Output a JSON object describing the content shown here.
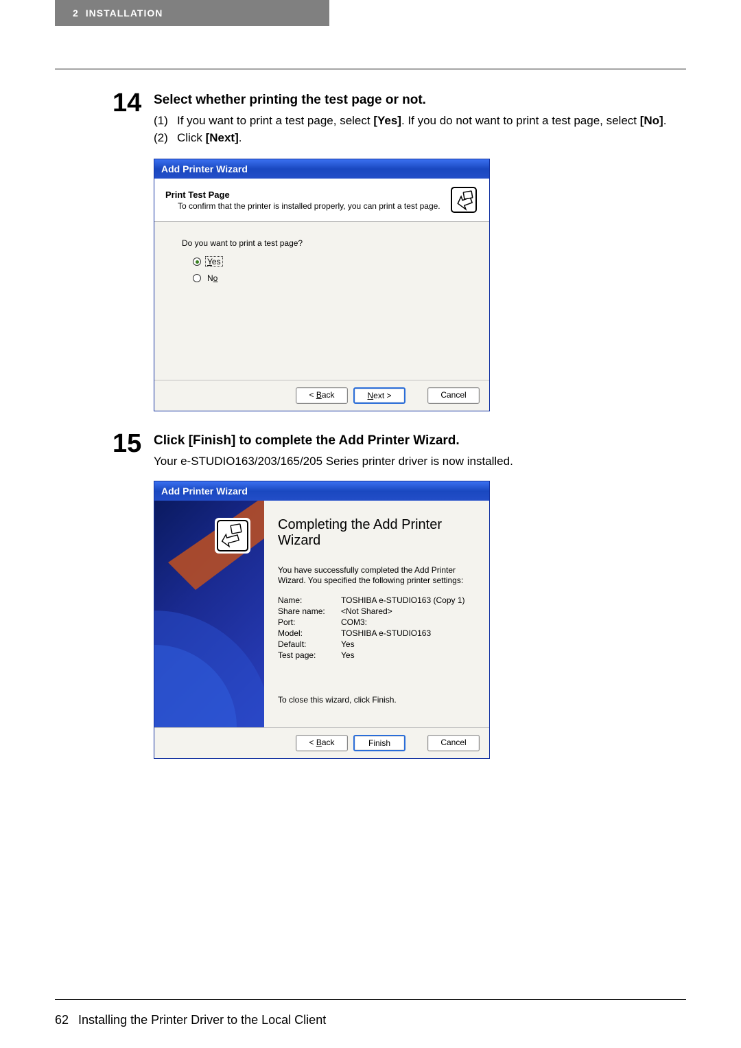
{
  "header": {
    "chapter_num": "2",
    "chapter_title": "INSTALLATION"
  },
  "step14": {
    "num": "14",
    "title": "Select whether printing the test page or not.",
    "sub1_num": "(1)",
    "sub1_text_a": "If you want to print a test page, select ",
    "sub1_bold_a": "[Yes]",
    "sub1_text_b": ". If you do not want to print a test page, select ",
    "sub1_bold_b": "[No]",
    "sub1_text_c": ".",
    "sub2_num": "(2)",
    "sub2_text_a": "Click ",
    "sub2_bold_a": "[Next]",
    "sub2_text_b": "."
  },
  "wizard1": {
    "title": "Add Printer Wizard",
    "header_title": "Print Test Page",
    "header_sub": "To confirm that the printer is installed properly, you can print a test page.",
    "question": "Do you want to print a test page?",
    "opt_yes_pre": "",
    "opt_yes_u": "Y",
    "opt_yes_post": "es",
    "opt_no_pre": "N",
    "opt_no_u": "o",
    "opt_no_post": "",
    "btn_back_pre": "< ",
    "btn_back_u": "B",
    "btn_back_post": "ack",
    "btn_next_u": "N",
    "btn_next_post": "ext >",
    "btn_cancel": "Cancel"
  },
  "step15": {
    "num": "15",
    "title": "Click [Finish] to complete the Add Printer Wizard.",
    "sub": "Your e-STUDIO163/203/165/205 Series printer driver is now installed."
  },
  "wizard2": {
    "title": "Add Printer Wizard",
    "complete_title": "Completing the Add Printer Wizard",
    "p1": "You have successfully completed the Add Printer Wizard. You specified the following printer settings:",
    "kv": {
      "name_k": "Name:",
      "name_v": "TOSHIBA e-STUDIO163 (Copy 1)",
      "share_k": "Share name:",
      "share_v": "<Not Shared>",
      "port_k": "Port:",
      "port_v": "COM3:",
      "model_k": "Model:",
      "model_v": "TOSHIBA e-STUDIO163",
      "default_k": "Default:",
      "default_v": "Yes",
      "test_k": "Test page:",
      "test_v": "Yes"
    },
    "close_text": "To close this wizard, click Finish.",
    "btn_back_pre": "< ",
    "btn_back_u": "B",
    "btn_back_post": "ack",
    "btn_finish": "Finish",
    "btn_cancel": "Cancel"
  },
  "footer": {
    "page_num": "62",
    "text": "Installing the Printer Driver to the Local Client"
  }
}
